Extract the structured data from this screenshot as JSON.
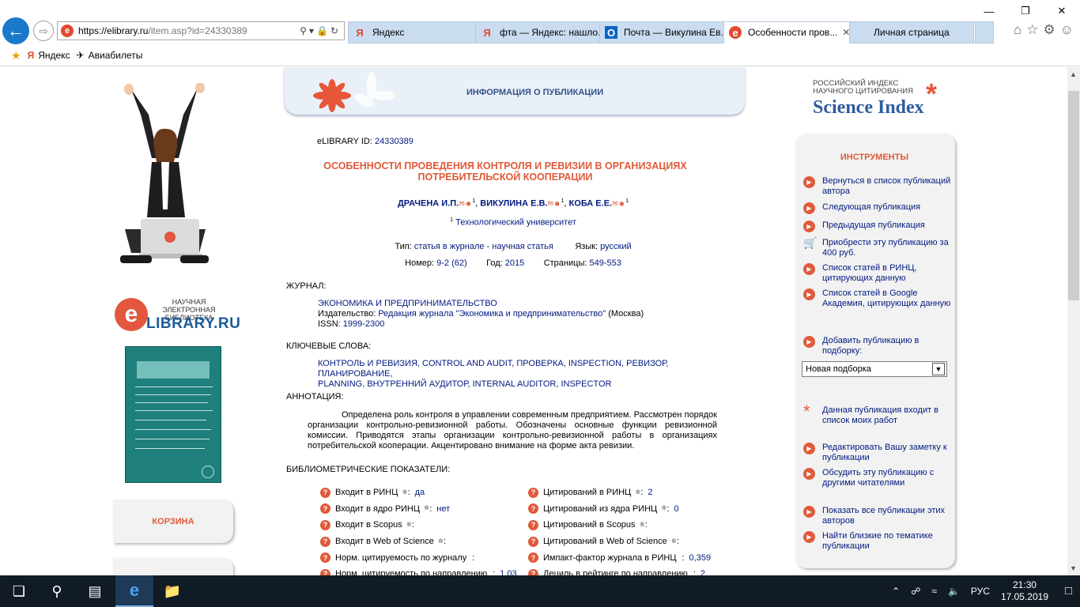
{
  "browser": {
    "url_host": "https://elibrary.ru",
    "url_path": "/item.asp?id=24330389",
    "tabs": [
      {
        "label": "Яндекс",
        "icon": "Я"
      },
      {
        "label": "фта — Яндекс: нашло...",
        "icon": "Я"
      },
      {
        "label": "Почта — Викулина Ев...",
        "icon": "O"
      },
      {
        "label": "Особенности пров...",
        "icon": "e"
      },
      {
        "label": "Личная страница",
        "icon": ""
      }
    ],
    "favorites": [
      "Яндекс",
      "Авиабилеты"
    ]
  },
  "header": {
    "title": "ИНФОРМАЦИЯ О ПУБЛИКАЦИИ"
  },
  "logo": {
    "small": "НАУЧНАЯ ЭЛЕКТРОННАЯ БИБЛИОТЕКА",
    "big": "LIBRARY.RU",
    "e": "e"
  },
  "left_buttons": {
    "cart": "КОРЗИНА"
  },
  "science_index": {
    "line1": "РОССИЙСКИЙ ИНДЕКС",
    "line2": "НАУЧНОГО ЦИТИРОВАНИЯ",
    "big": "Science Index"
  },
  "publication": {
    "id_label": "eLIBRARY ID:",
    "id": "24330389",
    "title_line1": "ОСОБЕННОСТИ ПРОВЕДЕНИЯ КОНТРОЛЯ И РЕВИЗИИ В ОРГАНИЗАЦИЯХ",
    "title_line2": "ПОТРЕБИТЕЛЬСКОЙ КООПЕРАЦИИ",
    "authors": [
      "ДРАЧЕНА И.П.",
      "ВИКУЛИНА Е.В.",
      "КОБА Е.Е."
    ],
    "affiliation_sup": "1",
    "affiliation": "Технологический университет",
    "type_label": "Тип:",
    "type": "статья в журнале - научная статья",
    "lang_label": "Язык:",
    "lang": "русский",
    "number_label": "Номер:",
    "number": "9-2 (62)",
    "year_label": "Год:",
    "year": "2015",
    "pages_label": "Страницы:",
    "pages": "549-553",
    "journal_heading": "ЖУРНАЛ:",
    "journal_name": "ЭКОНОМИКА И ПРЕДПРИНИМАТЕЛЬСТВО",
    "publisher_label": "Издательство:",
    "publisher": "Редакция журнала \"Экономика и предпринимательство\"",
    "publisher_city": "(Москва)",
    "issn_label": "ISSN:",
    "issn": "1999-2300",
    "keywords_heading": "КЛЮЧЕВЫЕ СЛОВА:",
    "keywords_line1": "КОНТРОЛЬ И РЕВИЗИЯ, CONTROL AND AUDIT, ПРОВЕРКА, INSPECTION, РЕВИЗОР, ПЛАНИРОВАНИЕ,",
    "keywords_line2": "PLANNING, ВНУТРЕННИЙ АУДИТОР, INTERNAL AUDITOR, INSPECTOR",
    "abstract_heading": "АННОТАЦИЯ:",
    "abstract": "Определена роль контроля в управлении современным предприятием. Рассмотрен порядок организации контрольно-ревизионной работы. Обозначены основные функции ревизионной комиссии. Приводятся этапы организации контрольно-ревизионной работы в организациях потребительской кооперации. Акцентировано внимание на форме акта ревизии.",
    "biblio_heading": "БИБЛИОМЕТРИЧЕСКИЕ ПОКАЗАТЕЛИ:"
  },
  "metrics_left": [
    {
      "label": "Входит в РИНЦ",
      "sup": "®",
      "value": "да"
    },
    {
      "label": "Входит в ядро РИНЦ",
      "sup": "®",
      "value": "нет"
    },
    {
      "label": "Входит в Scopus",
      "sup": "®",
      "value": ""
    },
    {
      "label": "Входит в Web of Science",
      "sup": "®",
      "value": ""
    },
    {
      "label": "Норм. цитируемость по журналу",
      "sup": "",
      "value": ""
    },
    {
      "label": "Норм. цитируемость по направлению",
      "sup": "",
      "value": "1,03"
    }
  ],
  "metrics_right": [
    {
      "label": "Цитирований в РИНЦ",
      "sup": "®",
      "value": "2"
    },
    {
      "label": "Цитирований из ядра РИНЦ",
      "sup": "®",
      "value": "0"
    },
    {
      "label": "Цитирований в Scopus",
      "sup": "®",
      "value": ""
    },
    {
      "label": "Цитирований в Web of Science",
      "sup": "®",
      "value": ""
    },
    {
      "label": "Импакт-фактор журнала в РИНЦ",
      "sup": "",
      "value": "0,359"
    },
    {
      "label": "Дециль в рейтинге по направлению",
      "sup": "",
      "value": "2"
    }
  ],
  "tools": {
    "title": "ИНСТРУМЕНТЫ",
    "items": [
      "Вернуться в список публикаций автора",
      "Следующая публикация",
      "Предыдущая публикация",
      "Приобрести эту публикацию за 400 руб.",
      "Список статей в РИНЦ, цитирующих данную",
      "Список статей в Google Академия, цитирующих данную",
      "Добавить публикацию в подборку:",
      "Данная публикация входит в список моих работ",
      "Редактировать Вашу заметку к публикации",
      "Обсудить эту публикацию с другими читателями",
      "Показать все публикации этих авторов",
      "Найти близкие по тематике публикации"
    ],
    "select_value": "Новая подборка"
  },
  "taskbar": {
    "lang": "РУС",
    "time": "21:30",
    "date": "17.05.2019"
  },
  "colors": {
    "accent": "#e05a3a",
    "link": "#001a80",
    "brand": "#2e5c9e"
  }
}
